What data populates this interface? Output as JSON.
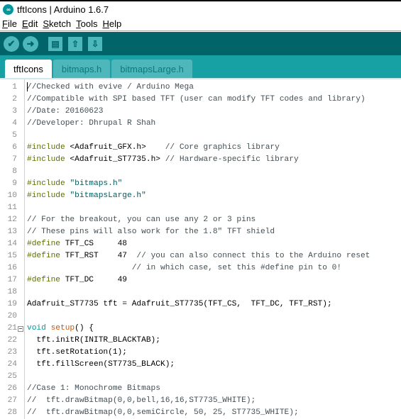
{
  "window": {
    "title": "tftIcons | Arduino 1.6.7",
    "logo_text": "∞"
  },
  "menu": [
    {
      "label": "File",
      "mnemonic": "F",
      "rest": "ile"
    },
    {
      "label": "Edit",
      "mnemonic": "E",
      "rest": "dit"
    },
    {
      "label": "Sketch",
      "mnemonic": "S",
      "rest": "ketch"
    },
    {
      "label": "Tools",
      "mnemonic": "T",
      "rest": "ools"
    },
    {
      "label": "Help",
      "mnemonic": "H",
      "rest": "elp"
    }
  ],
  "toolbar": {
    "verify_icon": "✔",
    "upload_icon": "➜",
    "new_icon": "▤",
    "open_icon": "⇧",
    "save_icon": "⇩"
  },
  "tabs": [
    {
      "label": "tftIcons",
      "active": true
    },
    {
      "label": "bitmaps.h",
      "active": false
    },
    {
      "label": "bitmapsLarge.h",
      "active": false
    }
  ],
  "colors": {
    "toolbar_bg": "#006468",
    "tabbar_bg": "#17a1a5",
    "button_bg": "#4db7bb",
    "keyword": "#00979c",
    "preprocessor": "#5e6d03",
    "string": "#005c5f",
    "function": "#d35400",
    "comment": "#434f54"
  },
  "code": [
    {
      "n": "1",
      "tokens": [
        {
          "t": "c",
          "v": "//Checked with evive / Arduino Mega"
        }
      ]
    },
    {
      "n": "2",
      "tokens": [
        {
          "t": "c",
          "v": "//Compatible with SPI based TFT (user can modify TFT codes and library)"
        }
      ]
    },
    {
      "n": "3",
      "tokens": [
        {
          "t": "c",
          "v": "//Date: 20160623"
        }
      ]
    },
    {
      "n": "4",
      "tokens": [
        {
          "t": "c",
          "v": "//Developer: Dhrupal R Shah"
        }
      ]
    },
    {
      "n": "5",
      "tokens": []
    },
    {
      "n": "6",
      "tokens": [
        {
          "t": "p",
          "v": "#include"
        },
        {
          "t": "x",
          "v": " <Adafruit_GFX.h>    "
        },
        {
          "t": "c",
          "v": "// Core graphics library"
        }
      ]
    },
    {
      "n": "7",
      "tokens": [
        {
          "t": "p",
          "v": "#include"
        },
        {
          "t": "x",
          "v": " <Adafruit_ST7735.h> "
        },
        {
          "t": "c",
          "v": "// Hardware-specific library"
        }
      ]
    },
    {
      "n": "8",
      "tokens": []
    },
    {
      "n": "9",
      "tokens": [
        {
          "t": "p",
          "v": "#include"
        },
        {
          "t": "x",
          "v": " "
        },
        {
          "t": "s",
          "v": "\"bitmaps.h\""
        }
      ]
    },
    {
      "n": "10",
      "tokens": [
        {
          "t": "p",
          "v": "#include"
        },
        {
          "t": "x",
          "v": " "
        },
        {
          "t": "s",
          "v": "\"bitmapsLarge.h\""
        }
      ]
    },
    {
      "n": "11",
      "tokens": []
    },
    {
      "n": "12",
      "tokens": [
        {
          "t": "c",
          "v": "// For the breakout, you can use any 2 or 3 pins"
        }
      ]
    },
    {
      "n": "13",
      "tokens": [
        {
          "t": "c",
          "v": "// These pins will also work for the 1.8\" TFT shield"
        }
      ]
    },
    {
      "n": "14",
      "tokens": [
        {
          "t": "p",
          "v": "#define"
        },
        {
          "t": "x",
          "v": " TFT_CS     48"
        }
      ]
    },
    {
      "n": "15",
      "tokens": [
        {
          "t": "p",
          "v": "#define"
        },
        {
          "t": "x",
          "v": " TFT_RST    47  "
        },
        {
          "t": "c",
          "v": "// you can also connect this to the Arduino reset"
        }
      ]
    },
    {
      "n": "16",
      "tokens": [
        {
          "t": "x",
          "v": "                      "
        },
        {
          "t": "c",
          "v": "// in which case, set this #define pin to 0!"
        }
      ]
    },
    {
      "n": "17",
      "tokens": [
        {
          "t": "p",
          "v": "#define"
        },
        {
          "t": "x",
          "v": " TFT_DC     49"
        }
      ]
    },
    {
      "n": "18",
      "tokens": []
    },
    {
      "n": "19",
      "tokens": [
        {
          "t": "x",
          "v": "Adafruit_ST7735 tft = Adafruit_ST7735(TFT_CS,  TFT_DC, TFT_RST);"
        }
      ]
    },
    {
      "n": "20",
      "tokens": []
    },
    {
      "n": "21",
      "fold": true,
      "tokens": [
        {
          "t": "k",
          "v": "void"
        },
        {
          "t": "x",
          "v": " "
        },
        {
          "t": "f",
          "v": "setup"
        },
        {
          "t": "x",
          "v": "() {"
        }
      ]
    },
    {
      "n": "22",
      "tokens": [
        {
          "t": "x",
          "v": "  tft.initR(INITR_BLACKTAB);"
        }
      ]
    },
    {
      "n": "23",
      "tokens": [
        {
          "t": "x",
          "v": "  tft.setRotation(1);"
        }
      ]
    },
    {
      "n": "24",
      "tokens": [
        {
          "t": "x",
          "v": "  tft.fillScreen(ST7735_BLACK);"
        }
      ]
    },
    {
      "n": "25",
      "tokens": []
    },
    {
      "n": "26",
      "tokens": [
        {
          "t": "c",
          "v": "//Case 1: Monochrome Bitmaps"
        }
      ]
    },
    {
      "n": "27",
      "tokens": [
        {
          "t": "c",
          "v": "//  tft.drawBitmap(0,0,bell,16,16,ST7735_WHITE);"
        }
      ]
    },
    {
      "n": "28",
      "tokens": [
        {
          "t": "c",
          "v": "//  tft.drawBitmap(0,0,semiCircle, 50, 25, ST7735_WHITE);"
        }
      ]
    }
  ]
}
